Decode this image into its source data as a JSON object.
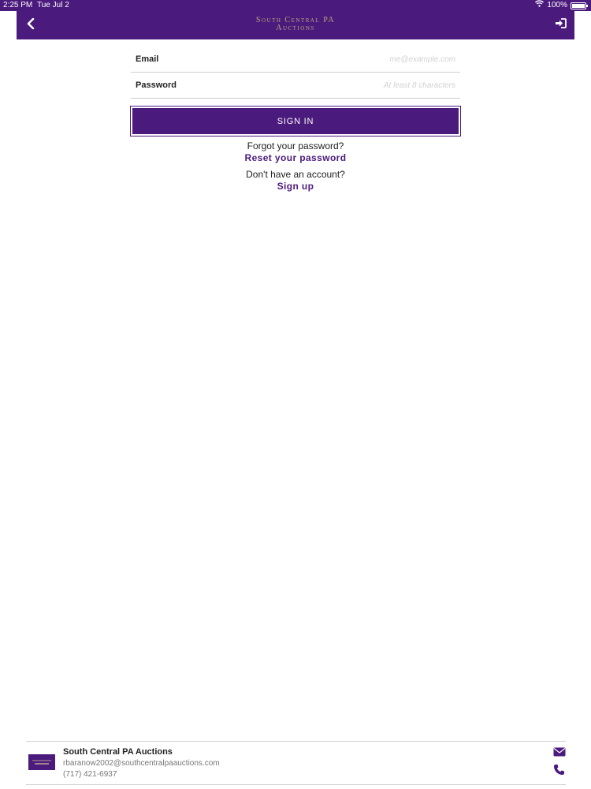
{
  "status_bar": {
    "time": "2:25 PM",
    "date": "Tue Jul 2",
    "battery": "100%",
    "icons": [
      "wifi-icon",
      "battery-icon"
    ]
  },
  "header": {
    "logo_line1": "South Central PA",
    "logo_line2": "Auctions",
    "icons": [
      "chevron-left-icon",
      "sign-in-icon"
    ]
  },
  "login_form": {
    "email_label": "Email",
    "email_placeholder": "me@example.com",
    "password_label": "Password",
    "password_placeholder": "At least 8 characters",
    "sign_in_label": "SIGN IN"
  },
  "links": {
    "forgot_prompt": "Forgot your password?",
    "reset_link": "Reset your password",
    "no_account_prompt": "Don't have an account?",
    "sign_up_link": "Sign up"
  },
  "footer": {
    "company_name": "South Central PA Auctions",
    "email": "rbaranow2002@southcentralpaauctions.com",
    "phone": "(717) 421-6937",
    "icons": [
      "envelope-icon",
      "phone-icon"
    ]
  },
  "colors": {
    "brand_purple": "#4b1a7d",
    "logo_gold": "#b9a57c"
  }
}
